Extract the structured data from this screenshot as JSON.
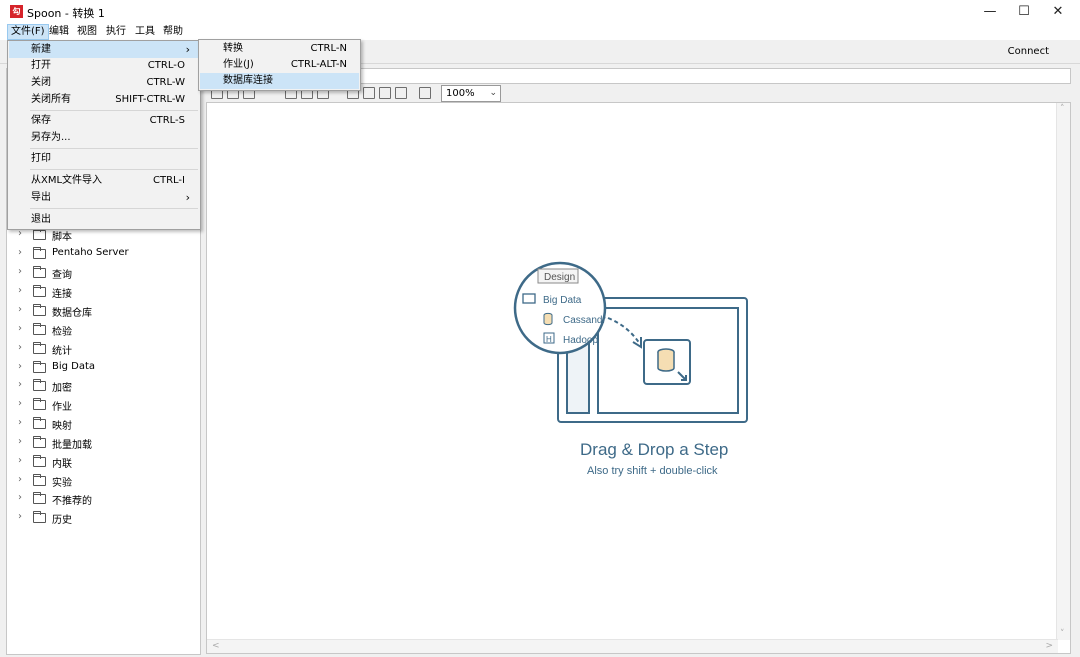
{
  "window": {
    "title": "Spoon - 转换 1",
    "app_icon_glyph": "勾",
    "controls": {
      "minimize": "—",
      "maximize": "☐",
      "close": "✕"
    }
  },
  "menubar": [
    {
      "label": "文件(F)",
      "active": true
    },
    {
      "label": "编辑"
    },
    {
      "label": "视图"
    },
    {
      "label": "执行"
    },
    {
      "label": "工具"
    },
    {
      "label": "帮助"
    }
  ],
  "toolbar": {
    "connect_label": "Connect"
  },
  "file_menu": {
    "items": [
      {
        "label": "新建",
        "shortcut": "",
        "submenu": true,
        "highlighted": true
      },
      {
        "label": "打开",
        "shortcut": "CTRL-O"
      },
      {
        "label": "关闭",
        "shortcut": "CTRL-W"
      },
      {
        "label": "关闭所有",
        "shortcut": "SHIFT-CTRL-W"
      },
      {
        "label": "保存",
        "shortcut": "CTRL-S"
      },
      {
        "label": "另存为...",
        "shortcut": ""
      },
      {
        "label": "打印",
        "shortcut": ""
      },
      {
        "label": "从XML文件导入",
        "shortcut": "CTRL-I"
      },
      {
        "label": "导出",
        "shortcut": "",
        "submenu": true
      },
      {
        "label": "退出",
        "shortcut": ""
      }
    ],
    "submenu_arrow": "›"
  },
  "new_submenu": {
    "items": [
      {
        "label": "转换",
        "shortcut": "CTRL-N"
      },
      {
        "label": "作业(J)",
        "shortcut": "CTRL-ALT-N"
      },
      {
        "label": "数据库连接",
        "shortcut": "",
        "highlighted": true
      }
    ]
  },
  "step_tree": {
    "items": [
      "脚本",
      "Pentaho Server",
      "查询",
      "连接",
      "数据仓库",
      "检验",
      "统计",
      "Big Data",
      "加密",
      "作业",
      "映射",
      "批量加载",
      "内联",
      "实验",
      "不推荐的",
      "历史"
    ],
    "chevron": "›"
  },
  "canvas_toolbar": {
    "zoom": "100%",
    "zoom_arrow": "⌄"
  },
  "canvas": {
    "illustration": {
      "tab_label": "Design",
      "folder_label": "Big Data",
      "item1": "Cassandr",
      "item2": "Hadoop",
      "item2_icon_letter": "H"
    },
    "drag_title": "Drag & Drop a Step",
    "drag_subtitle": "Also try shift + double-click",
    "scroll_up": "˄",
    "scroll_down": "˅",
    "scroll_left": "<",
    "scroll_right": ">"
  },
  "colors": {
    "illustration_stroke": "#3e6a88",
    "menu_highlight": "#cce4f7",
    "icon_red": "#d6232a"
  }
}
